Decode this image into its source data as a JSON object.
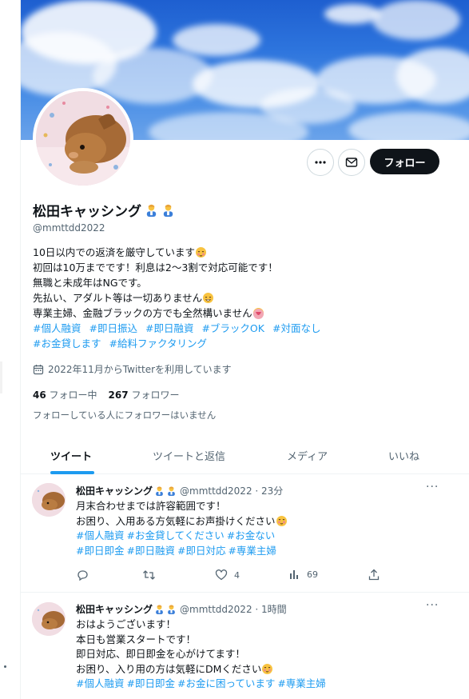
{
  "profile": {
    "name": "松田キャッシング",
    "handle": "@mmttdd2022",
    "bio_lines": [
      "10日以内での返済を厳守しています",
      "初回は10万までです！利息は2〜3割で対応可能です！",
      "無職と未成年はNGです。",
      "先払い、アダルト等は一切ありません",
      "専業主婦、金融ブラックの方でも全然構いません"
    ],
    "hashtags_line1": [
      "#個人融資",
      "#即日振込",
      "#即日融資",
      "#ブラックOK",
      "#対面なし"
    ],
    "hashtags_line2": [
      "#お金貸します",
      "#給料ファクタリング"
    ],
    "joined": "2022年11月からTwitterを利用しています",
    "following_count": "46",
    "following_label": "フォロー中",
    "followers_count": "267",
    "followers_label": "フォロワー",
    "not_followed_note": "フォローしている人にフォロワーはいません"
  },
  "buttons": {
    "follow_label": "フォロー"
  },
  "tabs": [
    {
      "label": "ツイート"
    },
    {
      "label": "ツイートと返信"
    },
    {
      "label": "メディア"
    },
    {
      "label": "いいね"
    }
  ],
  "tweets": [
    {
      "name": "松田キャッシング",
      "handle_time": "@mmttdd2022 · 23分",
      "lines": [
        "月末合わせまでは許容範囲です！",
        "お困り、入用ある方気軽にお声掛けください"
      ],
      "tags1": [
        "#個人融資",
        "#お金貸してください",
        "#お金ない"
      ],
      "tags2": [
        "#即日即金",
        "#即日融資",
        "#即日対応",
        "#専業主婦"
      ],
      "replies": "",
      "retweets": "",
      "likes": "4",
      "views": "69"
    },
    {
      "name": "松田キャッシング",
      "handle_time": "@mmttdd2022 · 1時間",
      "lines": [
        "おはようございます！",
        "本日も営業スタートです！",
        "即日対応、即日即金を心がけてます！",
        "お困り、入り用の方は気軽にDMください"
      ],
      "tags1": [
        "#個人融資",
        "#即日即金",
        "#お金に困っています",
        "#専業主婦"
      ]
    }
  ],
  "colors": {
    "accent": "#1d9bf0",
    "text": "#0f1419",
    "muted": "#536471",
    "border": "#eff3f4",
    "follow_bg": "#0f1419"
  },
  "icons": {
    "more": "more-horizontal-icon",
    "message": "envelope-icon",
    "calendar": "calendar-icon",
    "reply": "reply-icon",
    "retweet": "retweet-icon",
    "like": "heart-icon",
    "views": "views-icon",
    "share": "share-icon"
  }
}
